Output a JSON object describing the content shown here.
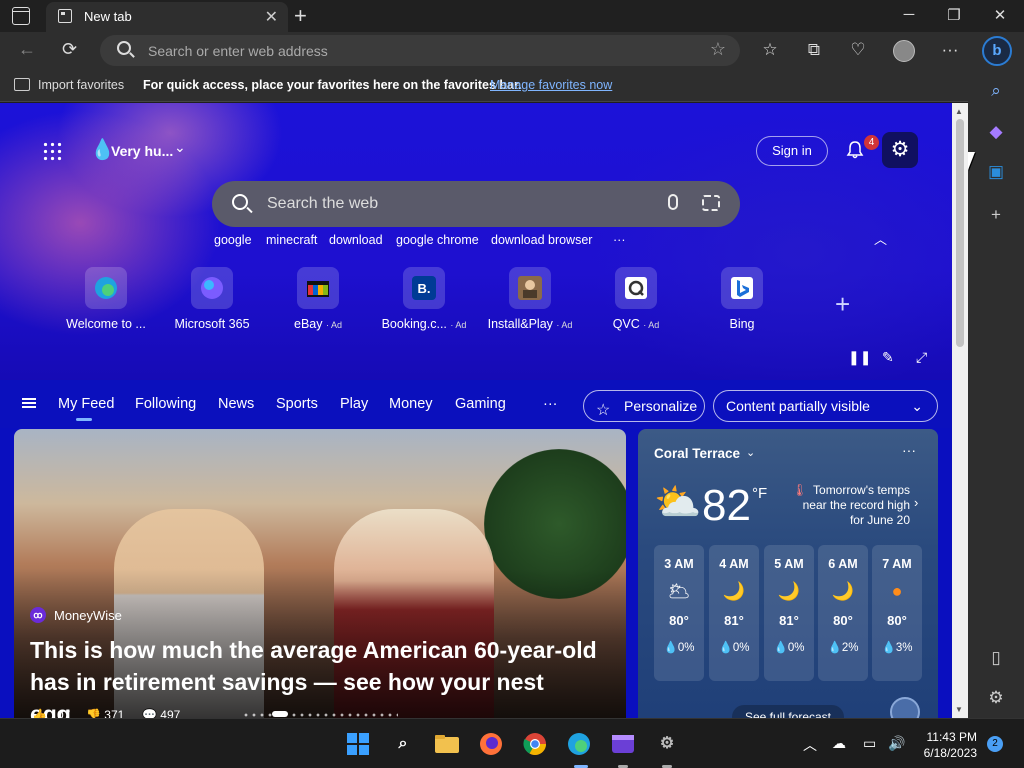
{
  "browser": {
    "tab_title": "New tab",
    "address_placeholder": "Search or enter web address"
  },
  "favorites_bar": {
    "import_label": "Import favorites",
    "message": "For quick access, place your favorites here on the favorites bar.",
    "manage_link": "Manage favorites now"
  },
  "header": {
    "weather_summary": "Very hu...",
    "sign_in": "Sign in",
    "notification_count": "4"
  },
  "search": {
    "placeholder": "Search the web",
    "suggestions": [
      "google",
      "minecraft",
      "download",
      "google chrome",
      "download browser"
    ],
    "more": "···"
  },
  "quick_links": [
    {
      "label": "Welcome to ...",
      "ad": "",
      "icon": "edge-icon"
    },
    {
      "label": "Microsoft 365",
      "ad": "",
      "icon": "m365-icon"
    },
    {
      "label": "eBay",
      "ad": "· Ad",
      "icon": "ebay-icon"
    },
    {
      "label": "Booking.c...",
      "ad": "· Ad",
      "icon": "booking-icon"
    },
    {
      "label": "Install&Play",
      "ad": "· Ad",
      "icon": "installplay-icon"
    },
    {
      "label": "QVC",
      "ad": "· Ad",
      "icon": "qvc-icon"
    },
    {
      "label": "Bing",
      "ad": "",
      "icon": "bing-icon"
    }
  ],
  "feed_nav": {
    "items": [
      "My Feed",
      "Following",
      "News",
      "Sports",
      "Play",
      "Money",
      "Gaming"
    ],
    "more": "···",
    "personalize": "Personalize",
    "content_visibility": "Content partially visible"
  },
  "article": {
    "source": "MoneyWise",
    "headline": "This is how much the average American 60-year-old has in retirement savings — see how your nest egg...",
    "likes": "107",
    "dislikes": "371",
    "comments": "497"
  },
  "weather": {
    "location": "Coral Terrace",
    "temp": "82",
    "unit": "°F",
    "alert": "Tomorrow's temps near the record high for June 20",
    "hours": [
      {
        "time": "3 AM",
        "temp": "80°",
        "precip": "0%",
        "icon": "partly-cloudy-night-icon"
      },
      {
        "time": "4 AM",
        "temp": "81°",
        "precip": "0%",
        "icon": "moon-icon"
      },
      {
        "time": "5 AM",
        "temp": "81°",
        "precip": "0%",
        "icon": "moon-icon"
      },
      {
        "time": "6 AM",
        "temp": "80°",
        "precip": "2%",
        "icon": "moon-icon"
      },
      {
        "time": "7 AM",
        "temp": "80°",
        "precip": "3%",
        "icon": "sun-icon"
      }
    ],
    "forecast_link": "See full forecast"
  },
  "taskbar": {
    "time": "11:43 PM",
    "date": "6/18/2023",
    "notifications": "2"
  }
}
